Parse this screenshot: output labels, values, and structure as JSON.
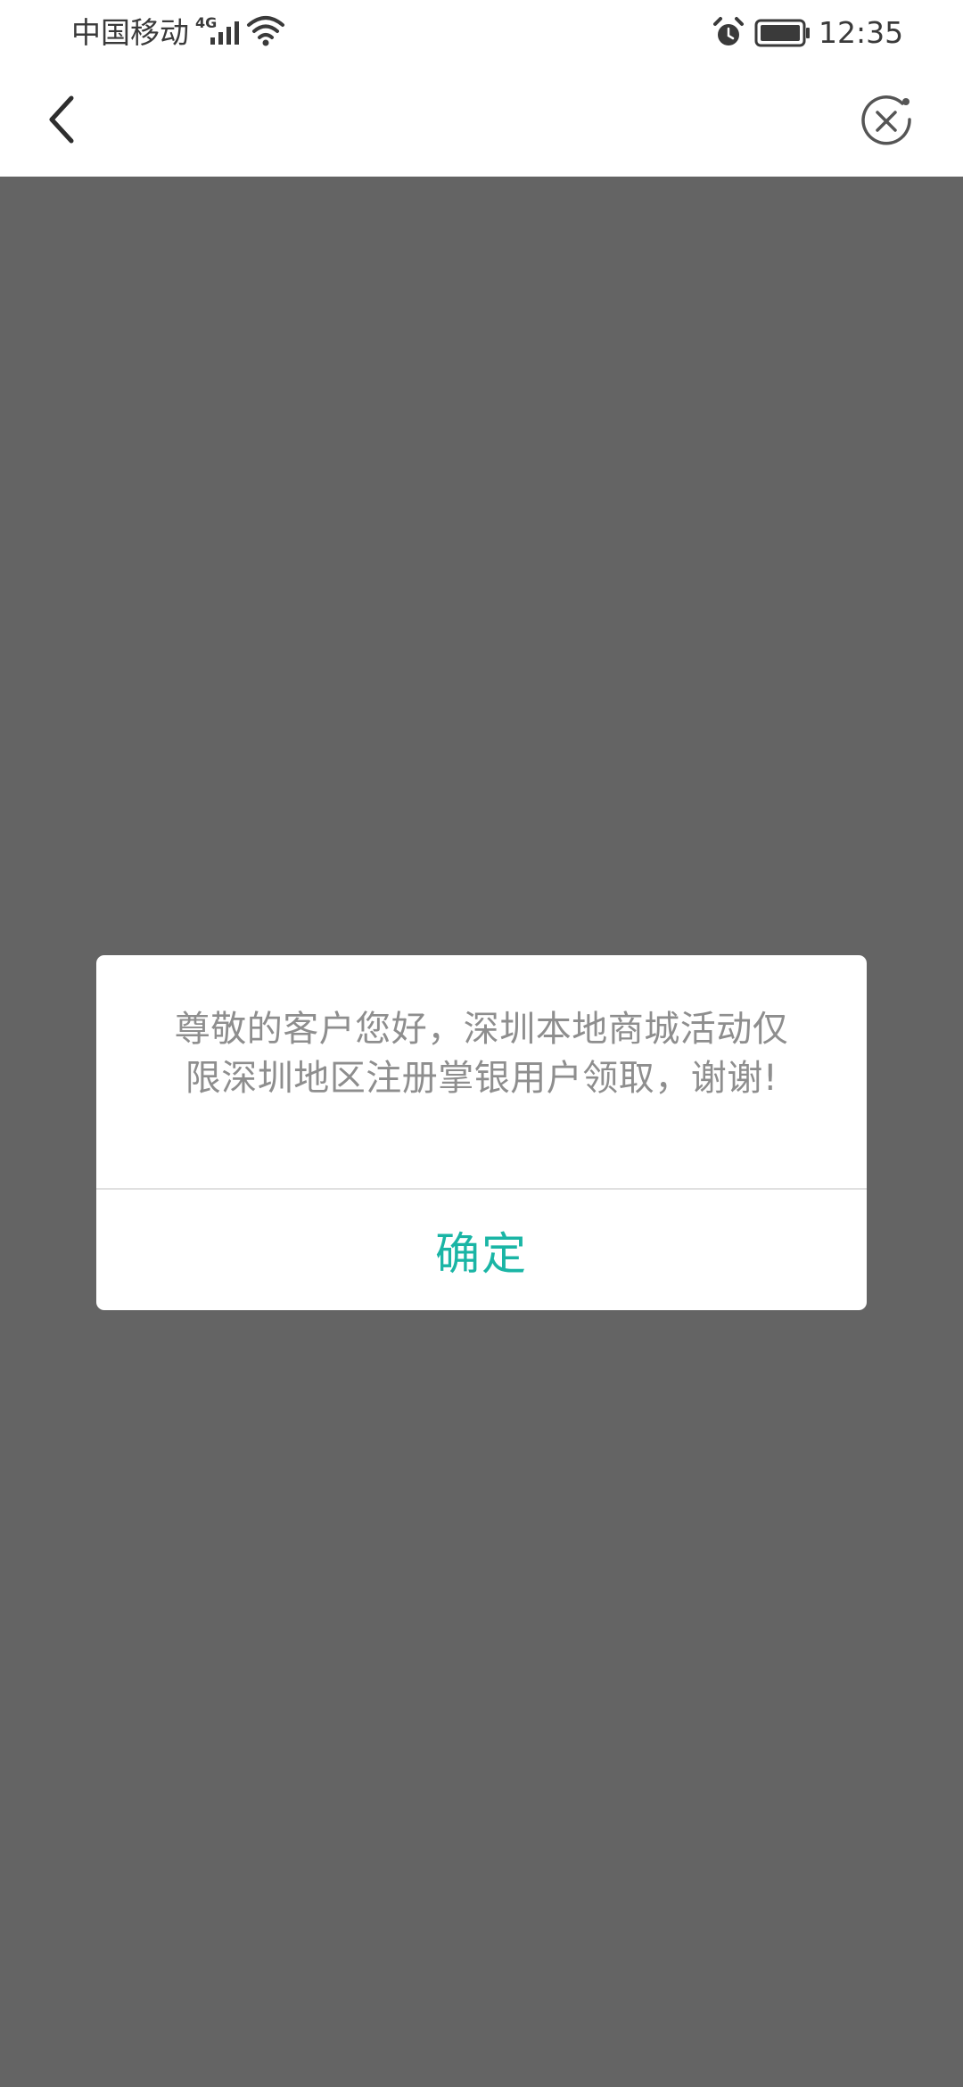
{
  "status_bar": {
    "carrier": "中国移动",
    "network_type": "4G",
    "time": "12:35",
    "icons": [
      "signal-icon",
      "wifi-icon",
      "alarm-icon",
      "battery-icon"
    ]
  },
  "nav_bar": {
    "back_icon": "chevron-left-icon",
    "close_icon": "close-circle-icon"
  },
  "dialog": {
    "message": "尊敬的客户您好，深圳本地商城活动仅限深圳地区注册掌银用户领取，谢谢!",
    "confirm_label": "确定"
  },
  "colors": {
    "overlay": "#646464",
    "accent": "#1ab5a5",
    "message_text": "#8e8e8e"
  }
}
